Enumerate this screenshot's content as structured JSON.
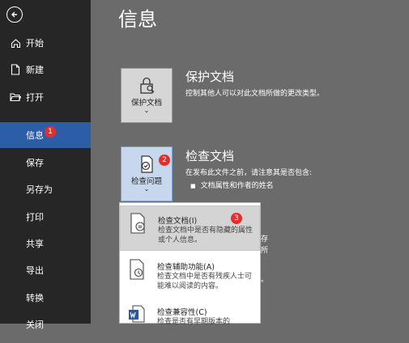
{
  "sidebar": {
    "items": [
      {
        "label": "开始",
        "icon": "home-icon"
      },
      {
        "label": "新建",
        "icon": "new-document-icon"
      },
      {
        "label": "打开",
        "icon": "open-folder-icon"
      },
      {
        "label": "信息",
        "active": true,
        "badge": "1"
      },
      {
        "label": "保存"
      },
      {
        "label": "另存为"
      },
      {
        "label": "打印"
      },
      {
        "label": "共享"
      },
      {
        "label": "导出"
      },
      {
        "label": "转换"
      },
      {
        "label": "关闭"
      }
    ]
  },
  "main": {
    "title": "信息",
    "protect": {
      "button_label": "保护文档",
      "title": "保护文档",
      "desc": "控制其他人可以对此文档所做的更改类型。"
    },
    "inspect": {
      "button_label": "检查问题",
      "badge": "2",
      "title": "检查文档",
      "desc": "在发布此文件之前，请注意其是否包含:",
      "bullet": "文档属性和作者的姓名"
    },
    "ghost_text": {
      "a": "存",
      "b": "所",
      "c": "。"
    }
  },
  "dropdown": {
    "badge": "3",
    "items": [
      {
        "title": "检查文档(I)",
        "desc": "检查文档中是否有隐藏的属性或个人信息。",
        "icon": "inspect-document-icon"
      },
      {
        "title": "检查辅助功能(A)",
        "desc": "检查文档中是否有残疾人士可能难以阅读的内容。",
        "icon": "accessibility-check-icon"
      },
      {
        "title": "检查兼容性(C)",
        "desc": "检查是否有早期版本的",
        "icon": "word-compatibility-icon"
      }
    ]
  },
  "colors": {
    "sidebar_bg": "#262626",
    "active_bg": "#2c5ea8",
    "badge": "#e0302e",
    "main_bg": "#6b6b6b"
  }
}
